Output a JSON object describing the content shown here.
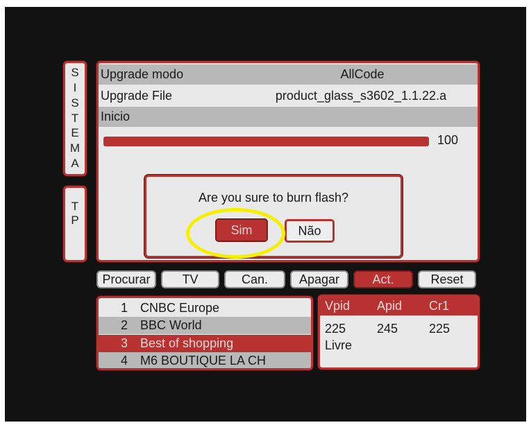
{
  "sidebar": {
    "sistema_letters": [
      "S",
      "I",
      "S",
      "T",
      "E",
      "M",
      "A"
    ],
    "tp_letters": [
      "T",
      "P"
    ]
  },
  "upgrade": {
    "rows": [
      {
        "label": "Upgrade modo",
        "value": "AllCode"
      },
      {
        "label": "Upgrade File",
        "value": "product_glass_s3602_1.1.22.a"
      },
      {
        "label": "Inicio",
        "value": ""
      }
    ],
    "progress_percent": 100,
    "progress_label": "100"
  },
  "dialog": {
    "message": "Are you sure to burn flash?",
    "yes_label": "Sim",
    "no_label": "Não"
  },
  "function_buttons": [
    {
      "label": "Procurar",
      "active": false
    },
    {
      "label": "TV",
      "active": false
    },
    {
      "label": "Can.",
      "active": false
    },
    {
      "label": "Apagar",
      "active": false
    },
    {
      "label": "Act.",
      "active": true
    },
    {
      "label": "Reset",
      "active": false
    }
  ],
  "channels": [
    {
      "num": "1",
      "name": "CNBC Europe"
    },
    {
      "num": "2",
      "name": "BBC World"
    },
    {
      "num": "3",
      "name": "Best of shopping"
    },
    {
      "num": "4",
      "name": "M6 BOUTIQUE LA CH"
    }
  ],
  "pids": {
    "headers": [
      "Vpid",
      "Apid",
      "Cr1"
    ],
    "values": [
      "225",
      "245",
      "225"
    ],
    "status": "Livre"
  },
  "colors": {
    "accent": "#b93232",
    "panel": "#e9e9e9",
    "stripe": "#b8b8b8",
    "highlight_ring": "#f5f000",
    "background": "#121212"
  }
}
